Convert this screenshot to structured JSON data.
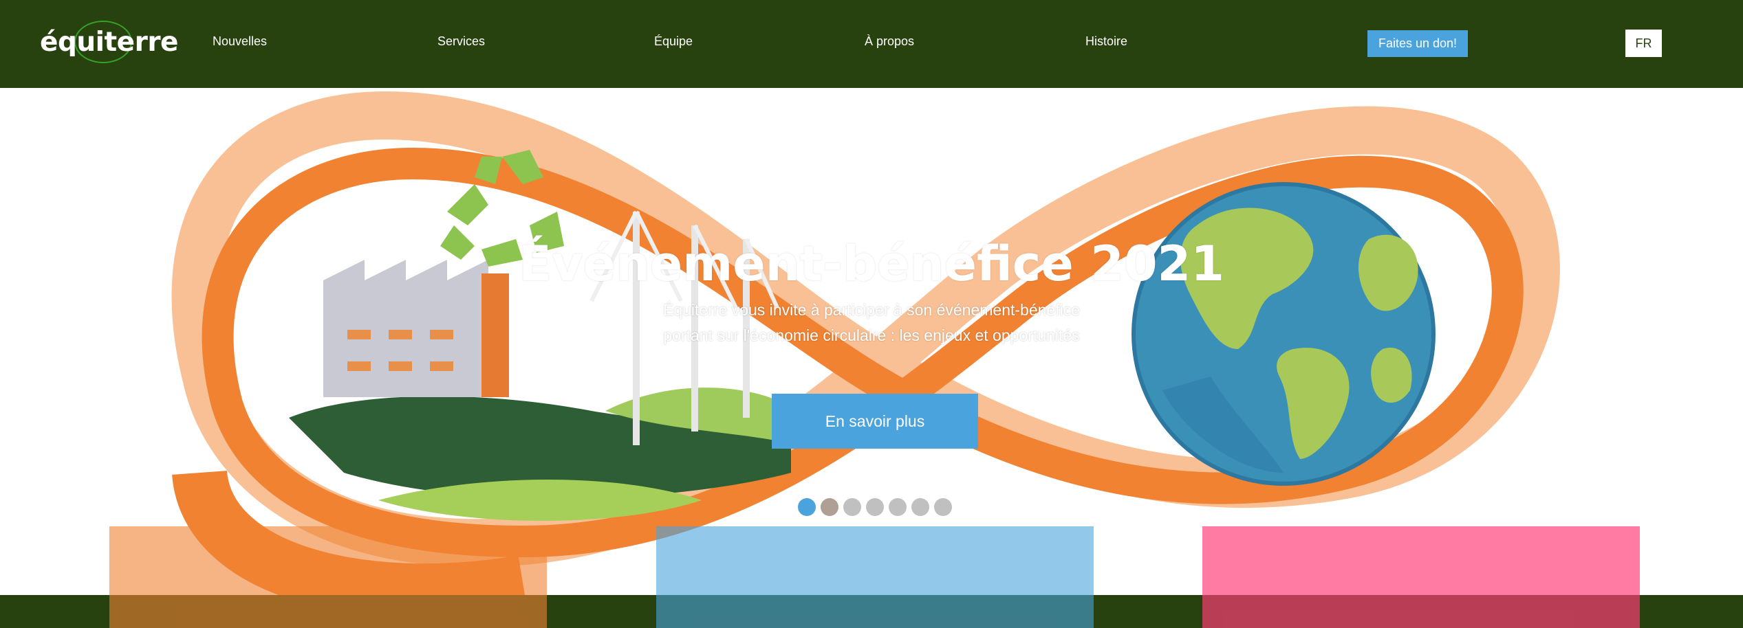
{
  "nav": {
    "logo_text": "équiterre",
    "links": [
      {
        "label": "Nouvelles"
      },
      {
        "label": "Services"
      },
      {
        "label": "Équipe"
      },
      {
        "label": "À propos"
      },
      {
        "label": "Histoire"
      }
    ],
    "donate_label": "Faites un don!",
    "lang_label": "FR"
  },
  "hero": {
    "title": "Événement-bénéfice 2021",
    "description_line1": "Équiterre vous invite à participer à son événement-bénéfice",
    "description_line2": "portant sur l'économie circulaire : les enjeux et opportunités",
    "cta_label": "En savoir plus",
    "slides": 7,
    "active_slide": 1
  },
  "colors": {
    "nav_bg": "#27410f",
    "accent_blue": "#4aa3dc",
    "card_orange": "#f08232",
    "card_blue": "#4aa3dc",
    "card_pink": "#ff3c78"
  }
}
